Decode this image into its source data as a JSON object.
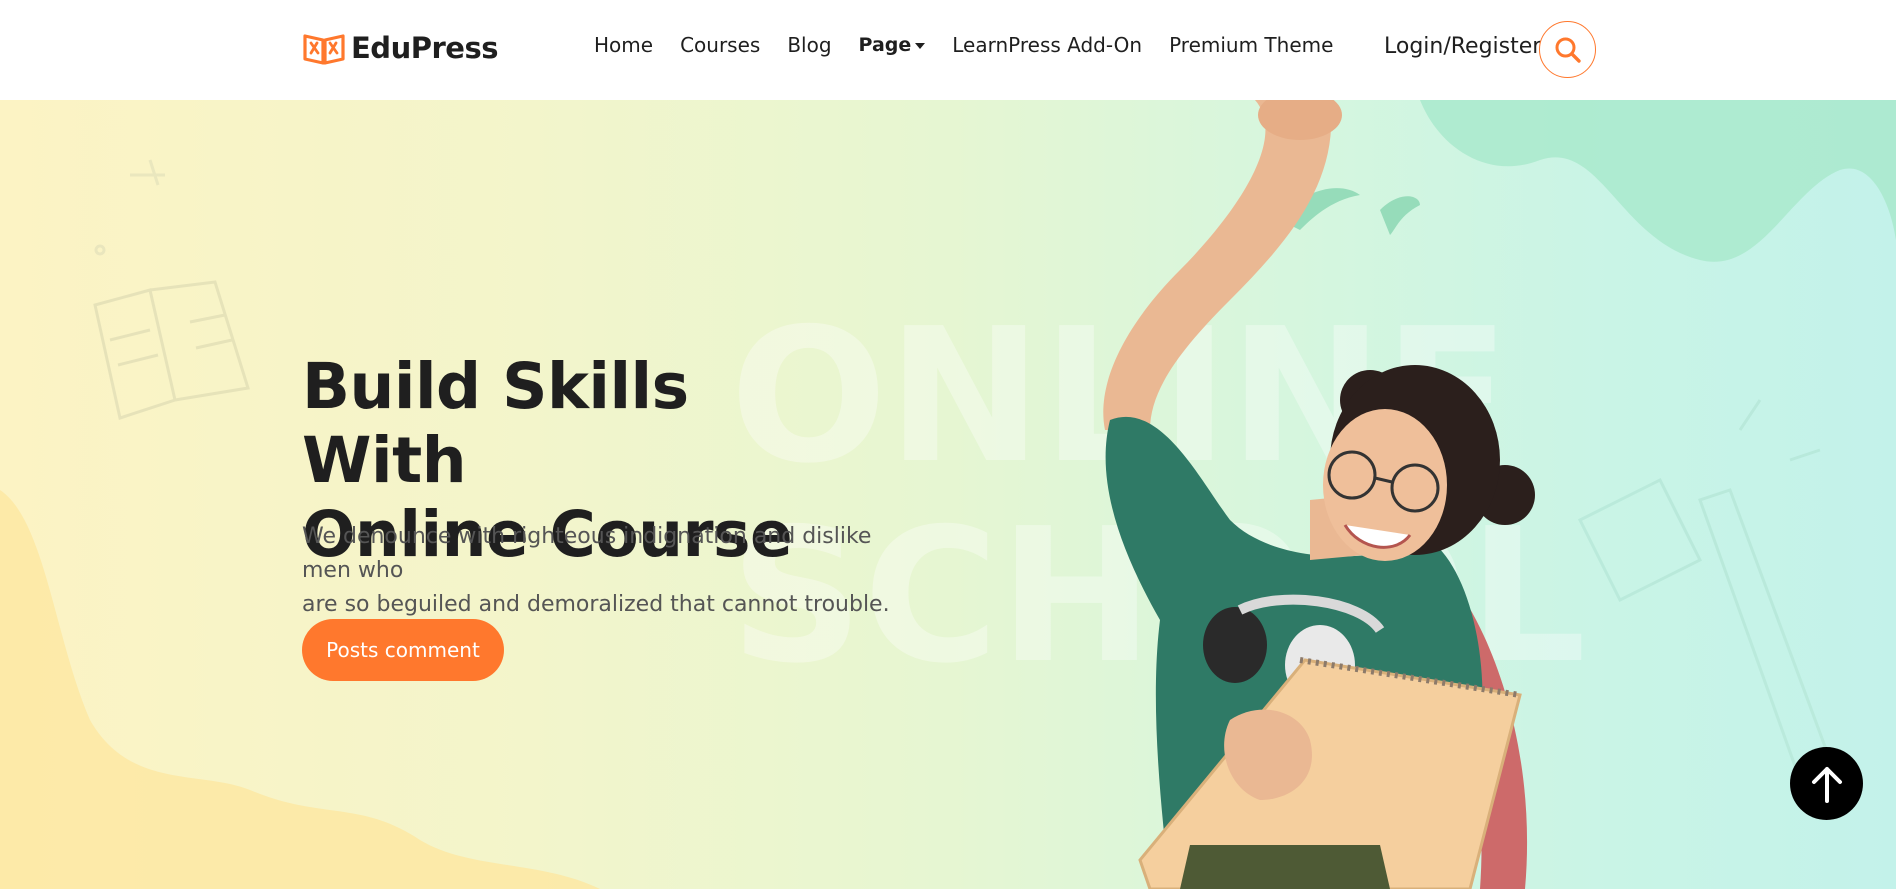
{
  "brand": {
    "name": "EduPress",
    "accent": "#ff782d"
  },
  "nav": {
    "items": [
      {
        "label": "Home"
      },
      {
        "label": "Courses"
      },
      {
        "label": "Blog"
      },
      {
        "label": "Page"
      },
      {
        "label": "LearnPress Add-On"
      },
      {
        "label": "Premium Theme"
      }
    ],
    "login_label": "Login/Register",
    "search_icon": "search-icon"
  },
  "hero": {
    "title_line1": "Build Skills With",
    "title_line2": "Online Course",
    "desc_line1": "We denounce with righteous indignation and dislike men who",
    "desc_line2": "are so beguiled and demoralized that cannot trouble.",
    "cta_label": "Posts comment",
    "watermark_line1": "ONLINE",
    "watermark_line2": "SCHOOL"
  },
  "scroll_top_icon": "arrow-up-icon"
}
